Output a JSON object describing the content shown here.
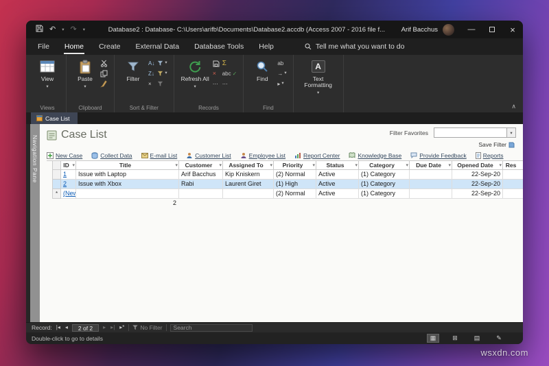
{
  "watermark": "wsxdn.com",
  "icons": {
    "undo": "↶",
    "redo": "↷",
    "dropdown": "▾",
    "sort_az": "A↓",
    "sort_za": "Z↓",
    "clear_sort": "×",
    "sigma": "Σ",
    "delete_x": "×",
    "spelling": "abc",
    "check": "✓",
    "more": "⋯",
    "replace": "ab",
    "goto": "→",
    "select_arrow": "▸",
    "minimize": "—",
    "close": "×",
    "collapse_ribbon": "∧",
    "first_record": "|◂",
    "prev_record": "◂",
    "next_record": "▸",
    "last_record": "▸|",
    "new_record": "▸*",
    "header_filter": "▾",
    "text_formatting_a": "A",
    "view_datasheet": "▦",
    "view_pivot": "⊞",
    "view_layout": "▤",
    "view_design": "✎"
  },
  "window": {
    "titlebar": {
      "title": "Database2 : Database- C:\\Users\\arifb\\Documents\\Database2.accdb (Access 2007 - 2016 file f...",
      "user_name": "Arif Bacchus"
    },
    "menubar": {
      "items": [
        "File",
        "Home",
        "Create",
        "External Data",
        "Database Tools",
        "Help"
      ],
      "tell_me": "Tell me what you want to do"
    },
    "ribbon": {
      "view": "View",
      "views_group": "Views",
      "paste": "Paste",
      "clipboard_group": "Clipboard",
      "filter": "Filter",
      "sort_filter_group": "Sort & Filter",
      "refresh": "Refresh All",
      "records_group": "Records",
      "find": "Find",
      "find_group": "Find",
      "text_formatting": "Text Formatting"
    },
    "doc_tab": "Case List",
    "nav_pane": "Navigation Pane",
    "form": {
      "title": "Case List",
      "filter_favorites": "Filter Favorites",
      "save_filter": "Save Filter",
      "links": [
        "New Case",
        "Collect Data",
        "E-mail List",
        "Customer List",
        "Employee List",
        "Report Center",
        "Knowledge Base",
        "Provide Feedback",
        "Reports"
      ]
    },
    "table": {
      "columns": [
        "ID",
        "Title",
        "Customer",
        "Assigned To",
        "Priority",
        "Status",
        "Category",
        "Due Date",
        "Opened Date",
        "Res"
      ],
      "rows": [
        [
          "1",
          "Issue with Laptop",
          "Arif Bacchus",
          "Kip Kniskern",
          "(2) Normal",
          "Active",
          "(1) Category",
          "",
          "22-Sep-20",
          ""
        ],
        [
          "2",
          "Issue with Xbox",
          "Rabi",
          "Laurent Giret",
          "(1) High",
          "Active",
          "(1) Category",
          "",
          "22-Sep-20",
          ""
        ],
        [
          "(New)",
          "",
          "",
          "",
          "(2) Normal",
          "Active",
          "(1) Category",
          "",
          "22-Sep-20",
          ""
        ]
      ],
      "new_row_marker": "*",
      "total_count": "2"
    },
    "record_nav": {
      "label": "Record:",
      "position": "2 of 2",
      "no_filter": "No Filter",
      "search_placeholder": "Search"
    },
    "status": {
      "message": "Double-click to go to details"
    }
  }
}
